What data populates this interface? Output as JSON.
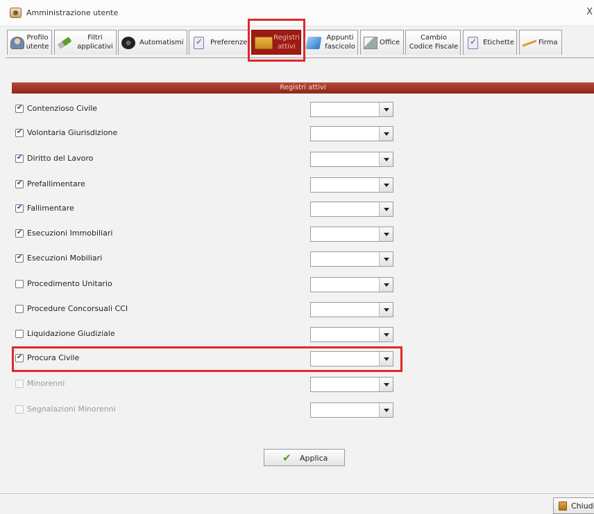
{
  "window": {
    "title": "Amministrazione utente",
    "close_glyph": "X"
  },
  "tabs": [
    {
      "lines": [
        "Profilo",
        "utente"
      ],
      "icon": "user-profile-icon"
    },
    {
      "lines": [
        "Filtri",
        "applicativi"
      ],
      "icon": "filter-icon"
    },
    {
      "lines": [
        "Automatismi"
      ],
      "icon": "gear-icon"
    },
    {
      "lines": [
        "Preferenze"
      ],
      "icon": "checklist-icon"
    },
    {
      "lines": [
        "Registri",
        "attivi"
      ],
      "icon": "folder-icon",
      "active": true
    },
    {
      "lines": [
        "Appunti",
        "fascicolo"
      ],
      "icon": "notebook-icon"
    },
    {
      "lines": [
        "Office"
      ],
      "icon": "office-icon"
    },
    {
      "lines": [
        "Cambio",
        "Codice Fiscale"
      ],
      "icon": "none"
    },
    {
      "lines": [
        "Etichette"
      ],
      "icon": "checklist-icon"
    },
    {
      "lines": [
        "Firma"
      ],
      "icon": "pen-icon"
    }
  ],
  "section": {
    "title": "Registri attivi"
  },
  "registri": [
    {
      "label": "Contenzioso Civile",
      "checked": true,
      "enabled": true,
      "value": ""
    },
    {
      "label": "Volontaria Giurisdizione",
      "checked": true,
      "enabled": true,
      "value": ""
    },
    {
      "label": "Diritto del Lavoro",
      "checked": true,
      "enabled": true,
      "value": ""
    },
    {
      "label": "Prefallimentare",
      "checked": true,
      "enabled": true,
      "value": ""
    },
    {
      "label": "Fallimentare",
      "checked": true,
      "enabled": true,
      "value": ""
    },
    {
      "label": "Esecuzioni Immobiliari",
      "checked": true,
      "enabled": true,
      "value": ""
    },
    {
      "label": "Esecuzioni Mobiliari",
      "checked": true,
      "enabled": true,
      "value": ""
    },
    {
      "label": "Procedimento Unitario",
      "checked": false,
      "enabled": true,
      "value": ""
    },
    {
      "label": "Procedure Concorsuali CCI",
      "checked": false,
      "enabled": true,
      "value": ""
    },
    {
      "label": "Liquidazione Giudiziale",
      "checked": false,
      "enabled": true,
      "value": ""
    },
    {
      "label": "Procura Civile",
      "checked": true,
      "enabled": true,
      "value": ""
    },
    {
      "label": "Minorenni",
      "checked": false,
      "enabled": false,
      "value": ""
    },
    {
      "label": "Segnalazioni Minorenni",
      "checked": false,
      "enabled": false,
      "value": ""
    }
  ],
  "buttons": {
    "apply": "Applica",
    "close": "Chiudi"
  },
  "colors": {
    "accent": "#9d1b12",
    "highlight": "#e0282b",
    "header": "#a3392b"
  }
}
